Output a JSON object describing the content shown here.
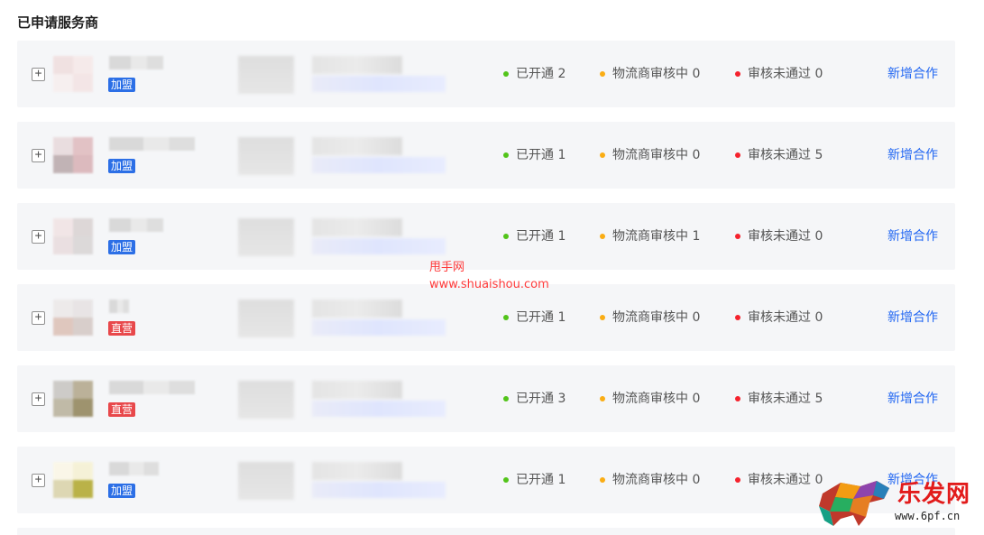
{
  "page": {
    "title": "已申请服务商"
  },
  "rows": [
    {
      "badge": "加盟",
      "badge_type": "join",
      "open": "已开通 2",
      "review": "物流商审核中 0",
      "rejected": "审核未通过 0",
      "action": "新增合作",
      "avatar_colors": [
        "#f0dede",
        "#f6e8e8",
        "#f7eeee",
        "#f3e3e3"
      ],
      "name_width": 60
    },
    {
      "badge": "加盟",
      "badge_type": "join",
      "open": "已开通 1",
      "review": "物流商审核中 0",
      "rejected": "审核未通过 5",
      "action": "新增合作",
      "avatar_colors": [
        "#e8d9db",
        "#dfb9bd",
        "#b9a8aa",
        "#d8b0b4"
      ],
      "name_width": 95
    },
    {
      "badge": "加盟",
      "badge_type": "join",
      "open": "已开通 1",
      "review": "物流商审核中 1",
      "rejected": "审核未通过 0",
      "action": "新增合作",
      "avatar_colors": [
        "#f1e3e4",
        "#d9d2d2",
        "#e9dcdd",
        "#d8d4d4"
      ],
      "name_width": 60
    },
    {
      "badge": "直营",
      "badge_type": "direct",
      "open": "已开通 1",
      "review": "物流商审核中 0",
      "rejected": "审核未通过 0",
      "action": "新增合作",
      "avatar_colors": [
        "#ece8e8",
        "#e6e2e2",
        "#dcbfb5",
        "#d4c8c4"
      ],
      "name_width": 22
    },
    {
      "badge": "直营",
      "badge_type": "direct",
      "open": "已开通 3",
      "review": "物流商审核中 0",
      "rejected": "审核未通过 5",
      "action": "新增合作",
      "avatar_colors": [
        "#c7c4c0",
        "#b1a689",
        "#b7b09a",
        "#8f8257"
      ],
      "name_width": 95
    },
    {
      "badge": "加盟",
      "badge_type": "join",
      "open": "已开通 1",
      "review": "物流商审核中 0",
      "rejected": "审核未通过 0",
      "action": "新增合作",
      "avatar_colors": [
        "#fbf7e6",
        "#f6f1d2",
        "#d9d2a7",
        "#b0a72a"
      ],
      "name_width": 55
    }
  ],
  "watermarks": {
    "center_line1": "甩手网",
    "center_line2": "www.shuaishou.com",
    "corner_brand": "乐发网",
    "corner_site": "www.6pf.cn"
  }
}
